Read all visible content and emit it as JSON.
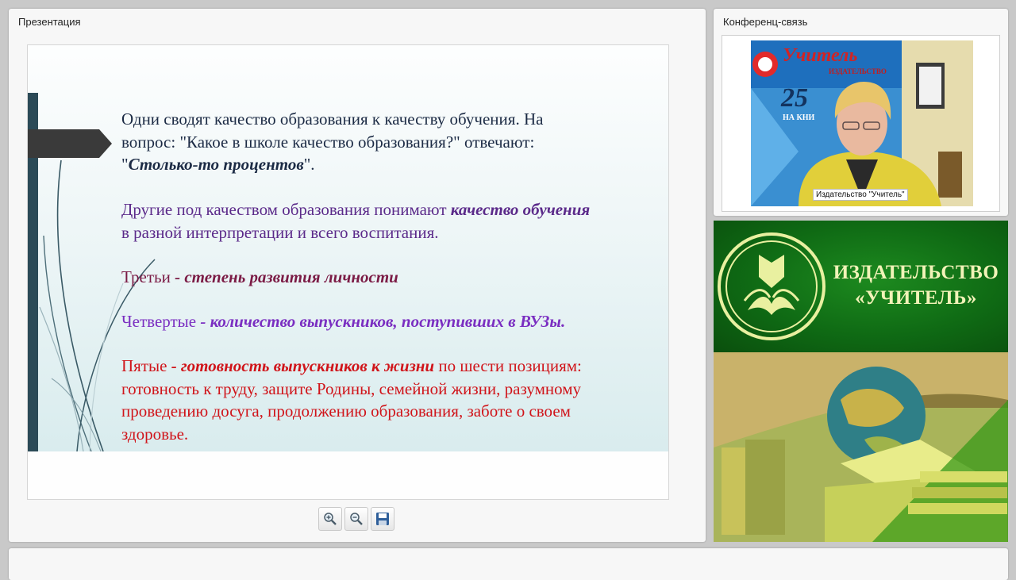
{
  "presentation": {
    "title": "Презентация",
    "slide": {
      "p1_line1": "Одни сводят качество образования к качеству обучения. На",
      "p1_line2": "вопрос: \"Какое в школе качество образования?\" отвечают:",
      "p1_quote_open": "\"",
      "p1_emphasis": "Столько-то процентов",
      "p1_quote_close": "\".",
      "p2_text": "Другие под качеством образования понимают ",
      "p2_emphasis": "качество обучения",
      "p2_line2": "в разной интерпретации и всего воспитания.",
      "p3_label": "Третьи ",
      "p3_emphasis": "- степень развития личности",
      "p4_label": "Четвертые ",
      "p4_emphasis": "- количество выпускников, поступивших в ВУЗы.",
      "p5_label": "Пятые ",
      "p5_emphasis": "- готовность выпускников к жизни",
      "p5_rest": " по шести позициям:",
      "p5_line2": "готовность к труду, защите Родины, семейной жизни, разумному",
      "p5_line3": "проведению досуга, продолжению образования, заботе о своем",
      "p5_line4": "здоровье."
    },
    "toolbar": {
      "zoom_in": "zoom-in-icon",
      "zoom_out": "zoom-out-icon",
      "save": "save-icon"
    }
  },
  "conference": {
    "title": "Конференц-связь",
    "video": {
      "caption": "Издательство \"Учитель\"",
      "wall_sign": "Учитель",
      "wall_sign_sub": "ИЗДАТЕЛЬСТВО",
      "wall_number": "25",
      "wall_sign_bottom": "НА КНИ"
    }
  },
  "brand": {
    "name_line1": "ИЗДАТЕЛЬСТВО",
    "name_line2": "«УЧИТЕЛЬ»"
  },
  "colors": {
    "slide_bar": "#2b4a57",
    "brand_green": "#0f6a14",
    "brand_text": "#f2f3b8",
    "text_red": "#d0141a",
    "text_violet": "#7a2ec1"
  }
}
